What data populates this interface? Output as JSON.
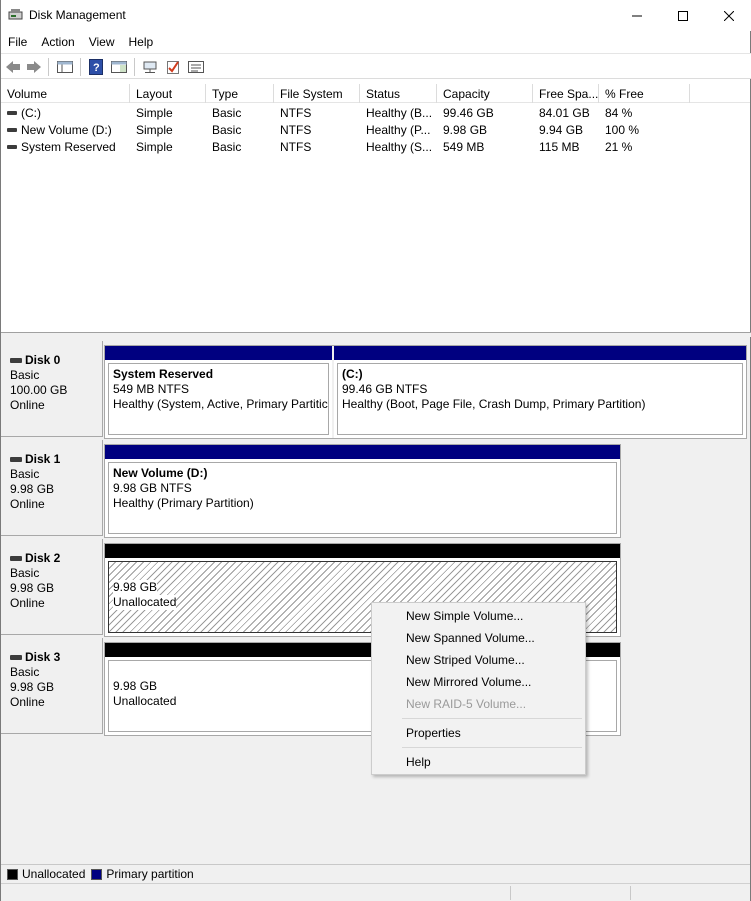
{
  "window": {
    "title": "Disk Management",
    "controls": [
      "minimize",
      "maximize",
      "close"
    ]
  },
  "menu": [
    "File",
    "Action",
    "View",
    "Help"
  ],
  "toolbar": {
    "icons": [
      "back-icon",
      "forward-icon",
      "console-tree-icon",
      "help-book-icon",
      "show-pane-icon",
      "connect-icon",
      "check-icon",
      "properties-icon"
    ]
  },
  "volume_table": {
    "columns": [
      "Volume",
      "Layout",
      "Type",
      "File System",
      "Status",
      "Capacity",
      "Free Spa...",
      "% Free"
    ],
    "rows": [
      {
        "volume": "(C:)",
        "layout": "Simple",
        "type": "Basic",
        "fs": "NTFS",
        "status": "Healthy (B...",
        "capacity": "99.46 GB",
        "free": "84.01 GB",
        "pct": "84 %"
      },
      {
        "volume": "New Volume (D:)",
        "layout": "Simple",
        "type": "Basic",
        "fs": "NTFS",
        "status": "Healthy (P...",
        "capacity": "9.98 GB",
        "free": "9.94 GB",
        "pct": "100 %"
      },
      {
        "volume": "System Reserved",
        "layout": "Simple",
        "type": "Basic",
        "fs": "NTFS",
        "status": "Healthy (S...",
        "capacity": "549 MB",
        "free": "115 MB",
        "pct": "21 %"
      }
    ]
  },
  "disks": [
    {
      "name": "Disk 0",
      "type": "Basic",
      "size": "100.00 GB",
      "state": "Online",
      "partitions": [
        {
          "name": "System Reserved",
          "detail": "549 MB NTFS",
          "status": "Healthy (System, Active, Primary Partitic",
          "color": "#000080"
        },
        {
          "name": "(C:)",
          "detail": "99.46 GB NTFS",
          "status": "Healthy (Boot, Page File, Crash Dump, Primary Partition)",
          "color": "#000080"
        }
      ]
    },
    {
      "name": "Disk 1",
      "type": "Basic",
      "size": "9.98 GB",
      "state": "Online",
      "partitions": [
        {
          "name": "New Volume  (D:)",
          "detail": "9.98 GB NTFS",
          "status": "Healthy (Primary Partition)",
          "color": "#000080"
        }
      ]
    },
    {
      "name": "Disk 2",
      "type": "Basic",
      "size": "9.98 GB",
      "state": "Online",
      "partitions": [
        {
          "detail": "9.98 GB",
          "status": "Unallocated",
          "color": "#000000",
          "selected": true
        }
      ]
    },
    {
      "name": "Disk 3",
      "type": "Basic",
      "size": "9.98 GB",
      "state": "Online",
      "partitions": [
        {
          "detail": "9.98 GB",
          "status": "Unallocated",
          "color": "#000000"
        }
      ]
    }
  ],
  "context_menu": {
    "items": [
      {
        "label": "New Simple Volume...",
        "enabled": true
      },
      {
        "label": "New Spanned Volume...",
        "enabled": true
      },
      {
        "label": "New Striped Volume...",
        "enabled": true
      },
      {
        "label": "New Mirrored Volume...",
        "enabled": true
      },
      {
        "label": "New RAID-5 Volume...",
        "enabled": false
      },
      {
        "label": "Properties",
        "enabled": true
      },
      {
        "label": "Help",
        "enabled": true
      }
    ]
  },
  "legend": [
    {
      "label": "Unallocated",
      "color": "#000000"
    },
    {
      "label": "Primary partition",
      "color": "#000080"
    }
  ]
}
